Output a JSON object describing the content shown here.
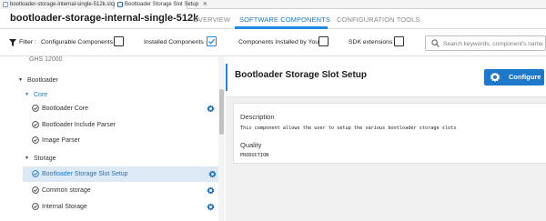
{
  "editor_tabs": [
    {
      "label": "bootloader-storage-internal-single-512k.slcp"
    },
    {
      "label": "Bootloader Storage Slot Setup",
      "close": "✕"
    }
  ],
  "header": {
    "project_title": "bootloader-storage-internal-single-512k",
    "nav": {
      "overview": "OVERVIEW",
      "software_components": "SOFTWARE COMPONENTS",
      "configuration_tools": "CONFIGURATION TOOLS"
    },
    "active_nav": "SOFTWARE COMPONENTS"
  },
  "filter_bar": {
    "filter_label": "Filter :",
    "configurable_label": "Configurable Components",
    "configurable_checked": false,
    "installed_label": "Installed Components",
    "installed_checked": true,
    "by_you_label": "Components Installed by You",
    "by_you_checked": false,
    "sdk_label": "SDK extensions",
    "sdk_checked": false,
    "search_placeholder": "Search keywords, component's name"
  },
  "tree": {
    "clipped_label": "GHS 12000",
    "bootloader": "Bootloader",
    "core": "Core",
    "core_items": [
      {
        "label": "Bootloader Core",
        "configurable": true
      },
      {
        "label": "Bootloader Include Parser",
        "configurable": false
      },
      {
        "label": "Image Parser",
        "configurable": false
      }
    ],
    "storage": "Storage",
    "storage_items": [
      {
        "label": "Bootloader Storage Slot Setup",
        "configurable": true,
        "selected": true
      },
      {
        "label": "Common storage",
        "configurable": true
      },
      {
        "label": "Internal Storage",
        "configurable": true
      }
    ]
  },
  "detail": {
    "title": "Bootloader Storage Slot Setup",
    "configure_label": "Configure",
    "description_heading": "Description",
    "description_text": "This component allows the user to setup the various bootloader storage slots",
    "quality_heading": "Quality",
    "quality_value": "PRODUCTION"
  },
  "colors": {
    "accent": "#1e88e5",
    "button": "#1e78c9",
    "selected_row": "#dde9f5"
  }
}
